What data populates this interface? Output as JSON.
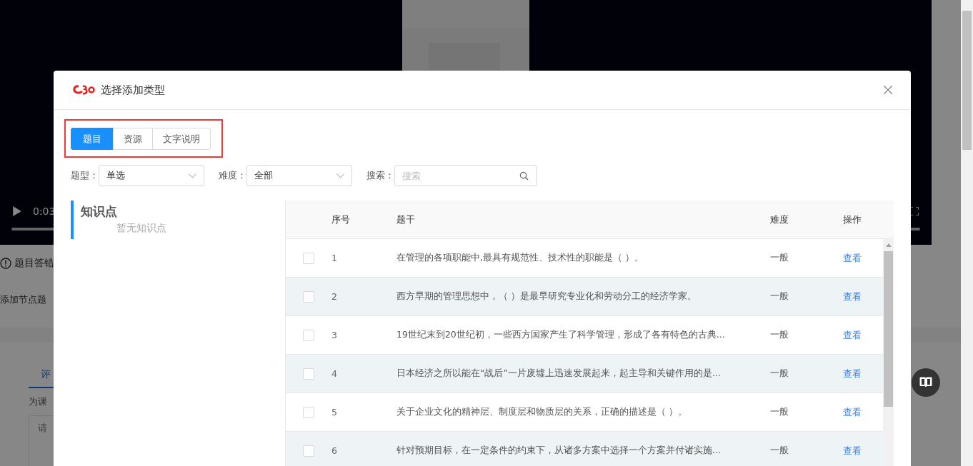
{
  "background_page": {
    "video": {
      "time": "0:03"
    },
    "notice": "题目答错",
    "add_node": "添加节点题",
    "tabs": [
      {
        "label": "评",
        "selected": true
      }
    ],
    "hint": "为课",
    "comment": {
      "placeholder": "请"
    }
  },
  "dialog": {
    "title": "选择添加类型",
    "tabs": [
      {
        "label": "题目",
        "selected": true
      },
      {
        "label": "资源",
        "selected": false
      },
      {
        "label": "文字说明",
        "selected": false
      }
    ],
    "filters": [
      {
        "kind": "select",
        "label": "题型：",
        "value": "单选"
      },
      {
        "kind": "select",
        "label": "难度：",
        "value": "全部"
      },
      {
        "kind": "search",
        "label": "搜索：",
        "placeholder": "搜索"
      }
    ],
    "knowledge_panel": {
      "title": "知识点",
      "empty_text": "暂无知识点"
    },
    "table": {
      "columns": [
        "序号",
        "题干",
        "难度",
        "操作"
      ],
      "rows": [
        {
          "checked": false,
          "number": "1",
          "stem": "在管理的各项职能中,最具有规范性、技术性的职能是（ ）。",
          "difficulty": "一般",
          "action": "查看"
        },
        {
          "checked": false,
          "number": "2",
          "stem": "西方早期的管理思想中，（ ）是最早研究专业化和劳动分工的经济学家。",
          "difficulty": "一般",
          "action": "查看"
        },
        {
          "checked": false,
          "number": "3",
          "stem": "19世纪末到20世纪初，一些西方国家产生了科学管理，形成了各有特色的古典...",
          "difficulty": "一般",
          "action": "查看"
        },
        {
          "checked": false,
          "number": "4",
          "stem": "日本经济之所以能在“战后”一片废墟上迅速发展起来，起主导和关键作用的是...",
          "difficulty": "一般",
          "action": "查看"
        },
        {
          "checked": false,
          "number": "5",
          "stem": "关于企业文化的精神层、制度层和物质层的关系，正确的描述是（ ）。",
          "difficulty": "一般",
          "action": "查看"
        },
        {
          "checked": false,
          "number": "6",
          "stem": "针对预期目标，在一定条件的约束下，从诸多方案中选择一个方案并付诸实施...",
          "difficulty": "一般",
          "action": "查看"
        }
      ]
    }
  }
}
